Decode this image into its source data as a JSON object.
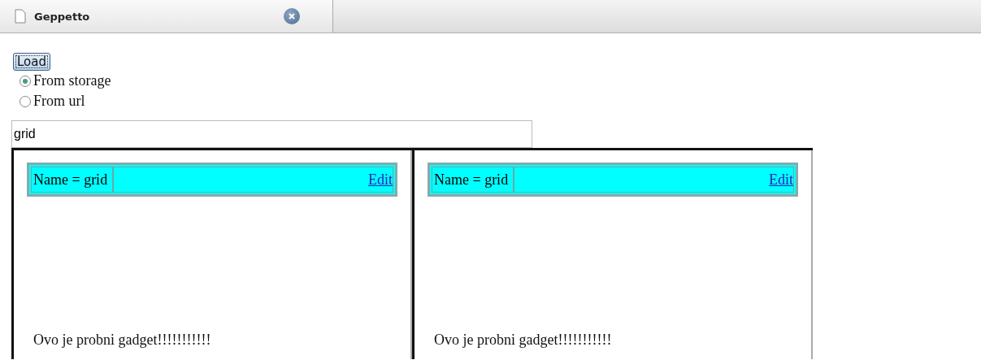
{
  "tab": {
    "title": "Geppetto"
  },
  "load_button": "Load",
  "sources": [
    {
      "label": "From storage",
      "selected": true
    },
    {
      "label": "From url",
      "selected": false
    }
  ],
  "name_field": {
    "value": "grid"
  },
  "gadgets": [
    {
      "name": "Name = grid",
      "edit": "Edit",
      "body": "Ovo je probni gadget!!!!!!!!!!!"
    },
    {
      "name": "Name = grid",
      "edit": "Edit",
      "body": "Ovo je probni gadget!!!!!!!!!!!"
    }
  ]
}
